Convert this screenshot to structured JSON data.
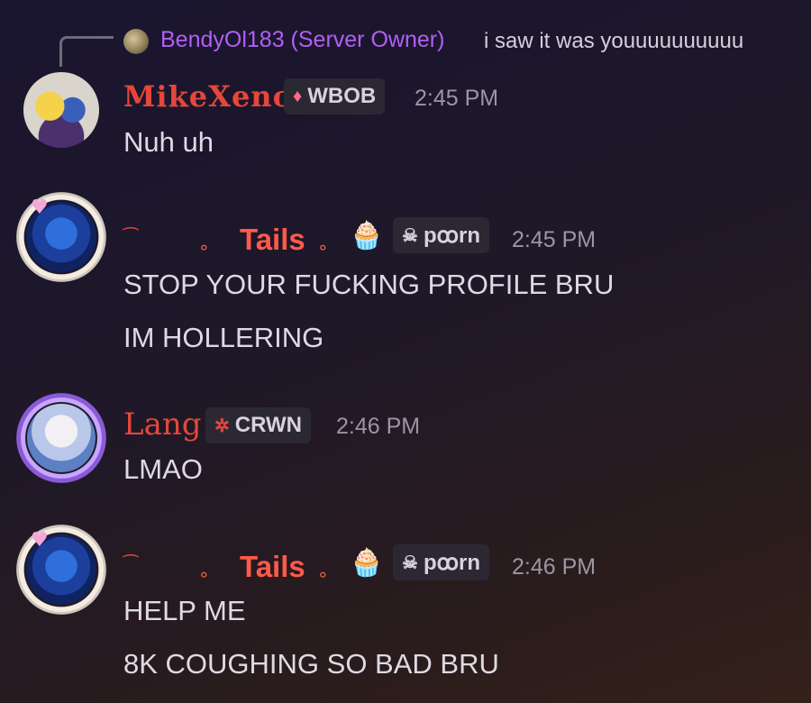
{
  "reply": {
    "author": "BendyOl183 (Server Owner)",
    "text": "i saw it was youuuuuuuuuu"
  },
  "messages": [
    {
      "author": "MikeXeno",
      "tag_icon": "gem-icon",
      "tag": "WBOB",
      "time": "2:45 PM",
      "lines": [
        "Nuh uh"
      ]
    },
    {
      "author": "Tails",
      "tag_icon": "skull-icon",
      "tag": "pꝏrn",
      "time": "2:45 PM",
      "lines": [
        "STOP YOUR FUCKING PROFILE BRU",
        "IM HOLLERING"
      ]
    },
    {
      "author": "Lang",
      "tag_icon": "spider-icon",
      "tag": "CRWN",
      "time": "2:46 PM",
      "lines": [
        "LMAO"
      ]
    },
    {
      "author": "Tails",
      "tag_icon": "skull-icon",
      "tag": "pꝏrn",
      "time": "2:46 PM",
      "lines": [
        "HELP ME",
        "8K COUGHING SO BAD BRU"
      ]
    }
  ],
  "colors": {
    "owner_name": "#b15ff5",
    "user_name": "#e5473b",
    "timestamp": "#9a96a4"
  }
}
